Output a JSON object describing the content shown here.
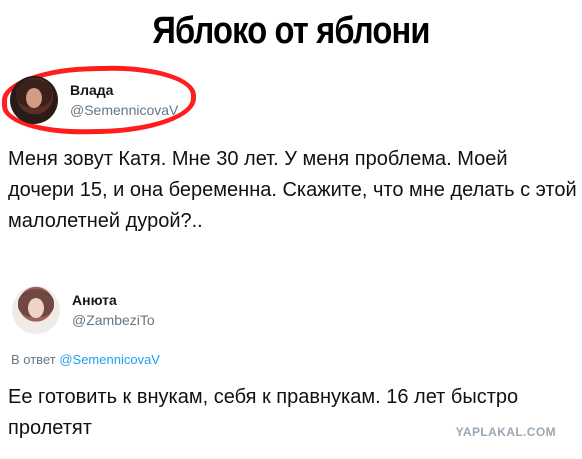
{
  "headline": "Яблоко от яблони",
  "tweet": {
    "author_name": "Влада",
    "author_handle": "@SemennicovaV",
    "text": "Меня зовут Катя. Мне 30 лет. У меня проблема. Моей дочери 15, и она беременна. Скажите, что мне делать с этой малолетней дурой?.."
  },
  "reply": {
    "author_name": "Анюта",
    "author_handle": "@ZambeziTo",
    "reply_prefix": "В ответ",
    "reply_to": "@SemennicovaV",
    "text": "Ее готовить к внукам, себя к правнукам. 16 лет быстро пролетят"
  },
  "watermark": "YAPLAKAL.COM",
  "colors": {
    "text": "#111111",
    "muted": "#657786",
    "link": "#1da1f2",
    "highlight": "#ff1d1d"
  }
}
